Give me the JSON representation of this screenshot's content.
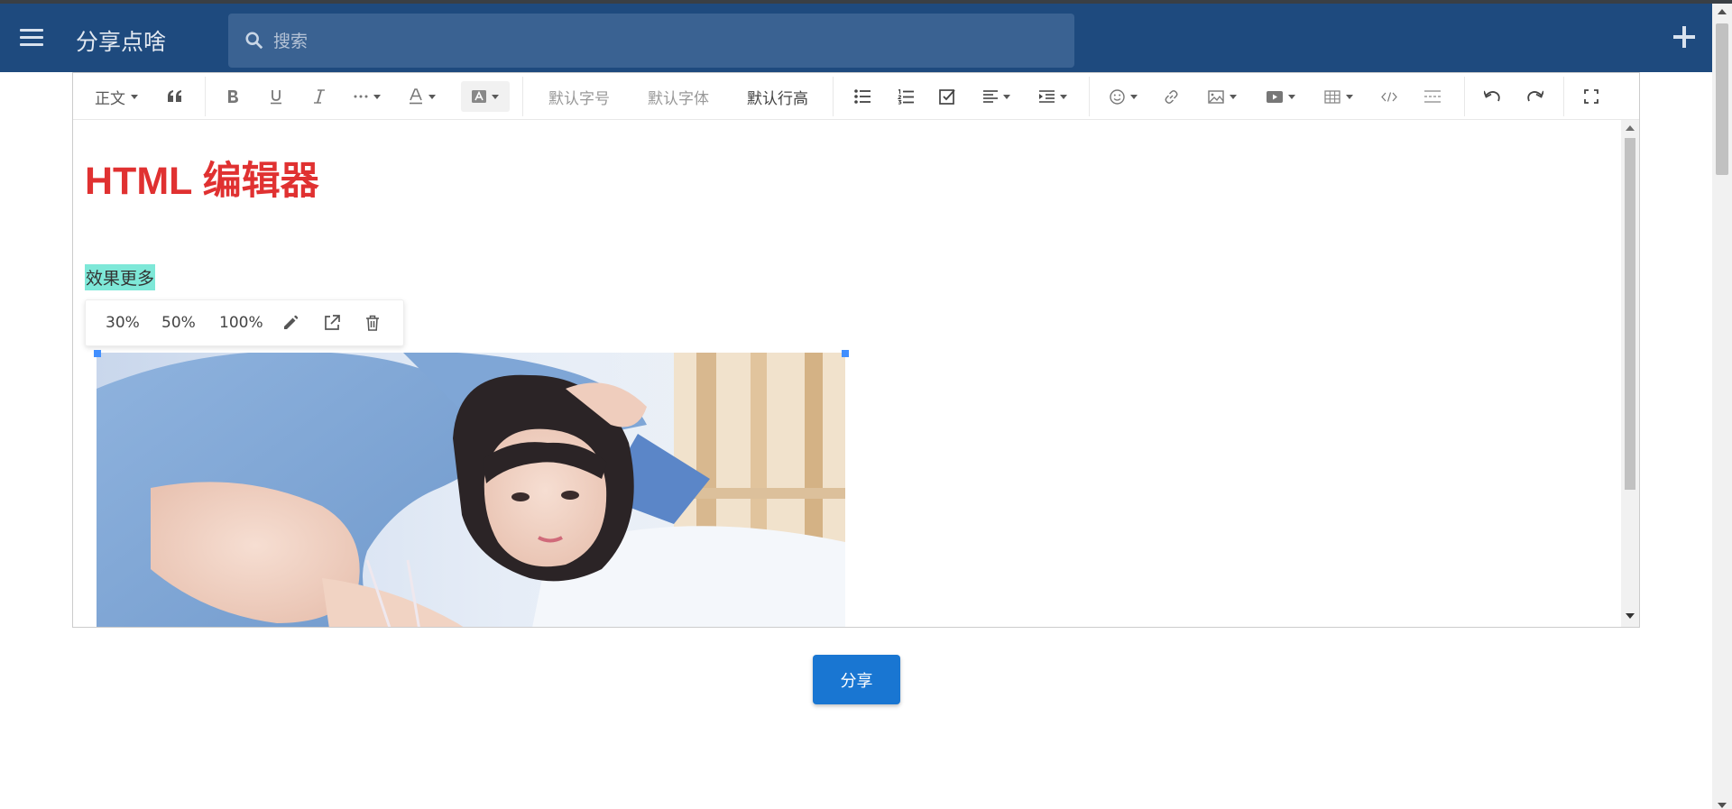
{
  "app": {
    "title": "分享点啥",
    "search_placeholder": "搜索"
  },
  "toolbar": {
    "paragraph_style": "正文",
    "font_size": "默认字号",
    "font_family": "默认字体",
    "line_height": "默认行高"
  },
  "content": {
    "heading": "HTML 编辑器",
    "highlighted_text": "效果更多"
  },
  "image_toolbar": {
    "sizes": [
      "30%",
      "50%",
      "100%"
    ]
  },
  "actions": {
    "share_label": "分享"
  },
  "colors": {
    "appbar": "#1e4a7e",
    "heading": "#e03131",
    "highlight": "#7ee8d8",
    "primary_button": "#1976d2",
    "resize_handle": "#418fff"
  },
  "icons": {
    "appbar": [
      "menu-icon",
      "search-icon",
      "plus-icon"
    ],
    "toolbar": [
      "quote-icon",
      "bold-icon",
      "underline-icon",
      "italic-icon",
      "more-icon",
      "font-color-icon",
      "background-color-icon",
      "bulleted-list-icon",
      "numbered-list-icon",
      "todo-icon",
      "justify-icon",
      "indent-icon",
      "emotion-icon",
      "link-icon",
      "image-icon",
      "video-icon",
      "table-icon",
      "code-block-icon",
      "divider-icon",
      "undo-icon",
      "redo-icon",
      "fullscreen-icon"
    ],
    "image_toolbar": [
      "edit-icon",
      "open-link-icon",
      "delete-icon"
    ]
  }
}
